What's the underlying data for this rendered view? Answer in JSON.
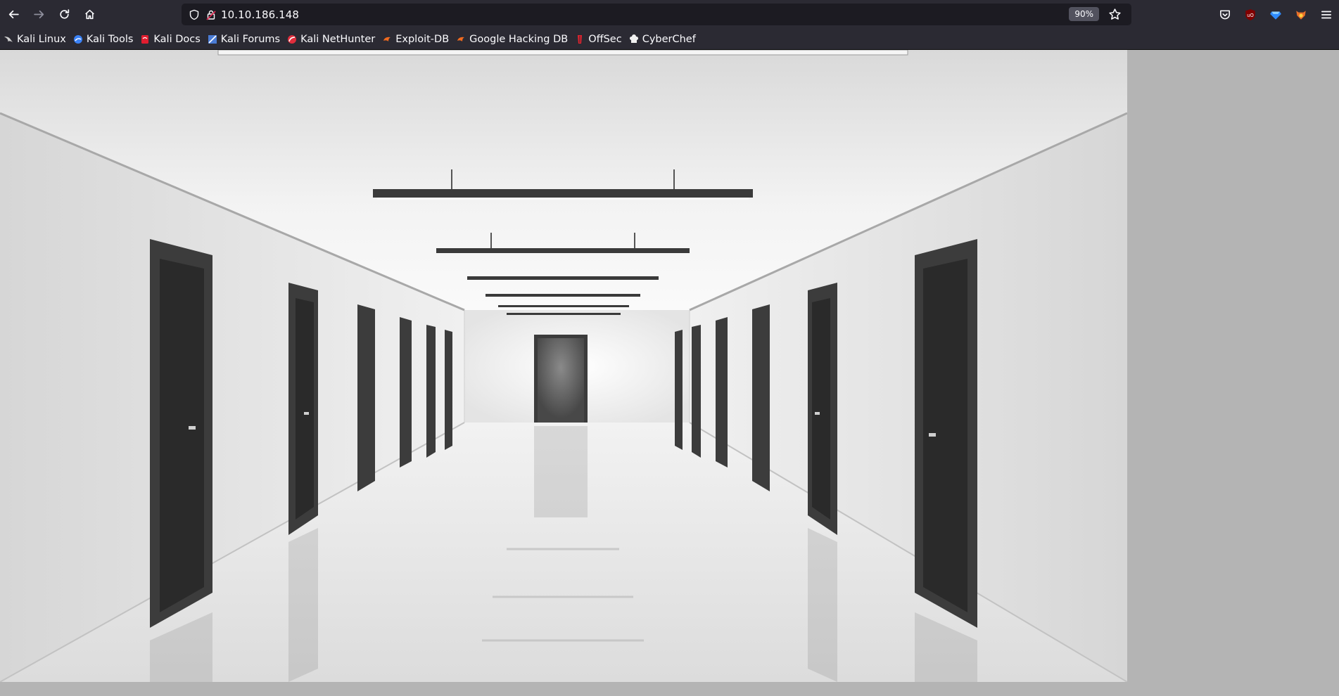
{
  "browser": {
    "url": "10.10.186.148",
    "zoom": "90%",
    "icons": {
      "back": "arrow-left-icon",
      "forward": "arrow-right-icon",
      "reload": "reload-icon",
      "home": "home-icon",
      "shield": "shield-icon",
      "lock": "insecure-lock-icon",
      "bookmark": "star-icon",
      "pocket": "pocket-icon",
      "ublock": "ublock-origin-icon",
      "ext2": "extension-gem-icon",
      "ext3": "foxyproxy-icon",
      "menu": "hamburger-menu-icon"
    }
  },
  "bookmarks": [
    {
      "label": "Kali Linux",
      "color": "#d0d0d0"
    },
    {
      "label": "Kali Tools",
      "color": "#3b82f6"
    },
    {
      "label": "Kali Docs",
      "color": "#e11d2f"
    },
    {
      "label": "Kali Forums",
      "color": "#4a7bd4"
    },
    {
      "label": "Kali NetHunter",
      "color": "#e02d3c"
    },
    {
      "label": "Exploit-DB",
      "color": "#f06a1f"
    },
    {
      "label": "Google Hacking DB",
      "color": "#f06a1f"
    },
    {
      "label": "OffSec",
      "color": "#e4232e"
    },
    {
      "label": "CyberChef",
      "color": "#f0f0f0"
    }
  ],
  "page": {
    "image": "white-corridor-with-dark-doors-image"
  }
}
